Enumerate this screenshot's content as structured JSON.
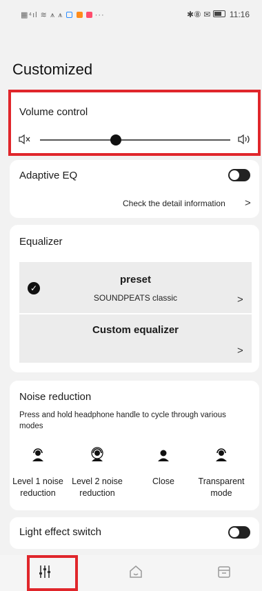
{
  "status_bar": {
    "left_more": "···",
    "right_icons": "✱⑧ ✉",
    "time": "11:16"
  },
  "page": {
    "title": "Customized"
  },
  "volume": {
    "title": "Volume control",
    "level": 0.4,
    "mute_icon": "speaker-muted-icon",
    "loud_icon": "speaker-loud-icon"
  },
  "adaptive_eq": {
    "label": "Adaptive EQ",
    "enabled": false,
    "detail_link": "Check the detail information",
    "chevron": ">"
  },
  "equalizer": {
    "title": "Equalizer",
    "items": [
      {
        "label": "preset",
        "sublabel": "SOUNDPEATS classic",
        "selected": true,
        "chevron": ">"
      },
      {
        "label": "Custom equalizer",
        "selected": false,
        "chevron": ">"
      }
    ]
  },
  "noise_reduction": {
    "title": "Noise reduction",
    "description": "Press and hold headphone handle to cycle through various modes",
    "modes": [
      {
        "label": "Level 1 noise reduction",
        "icon": "person-headphone-icon"
      },
      {
        "label": "Level 2 noise reduction",
        "icon": "person-headphone-ring-icon"
      },
      {
        "label": "Close",
        "icon": "person-icon"
      },
      {
        "label": "Transparent mode",
        "icon": "person-headphone-icon"
      }
    ]
  },
  "light_effect": {
    "label": "Light effect switch",
    "enabled": false
  },
  "tab_bar": {
    "tabs": [
      {
        "name": "equalizer-settings",
        "icon": "sliders-icon",
        "active": true
      },
      {
        "name": "home",
        "icon": "home-icon",
        "active": false
      },
      {
        "name": "store",
        "icon": "store-icon",
        "active": false
      }
    ]
  },
  "colors": {
    "highlight": "#e0262b",
    "background": "#f2f2f2",
    "card": "#ffffff",
    "accent": "#111111"
  }
}
